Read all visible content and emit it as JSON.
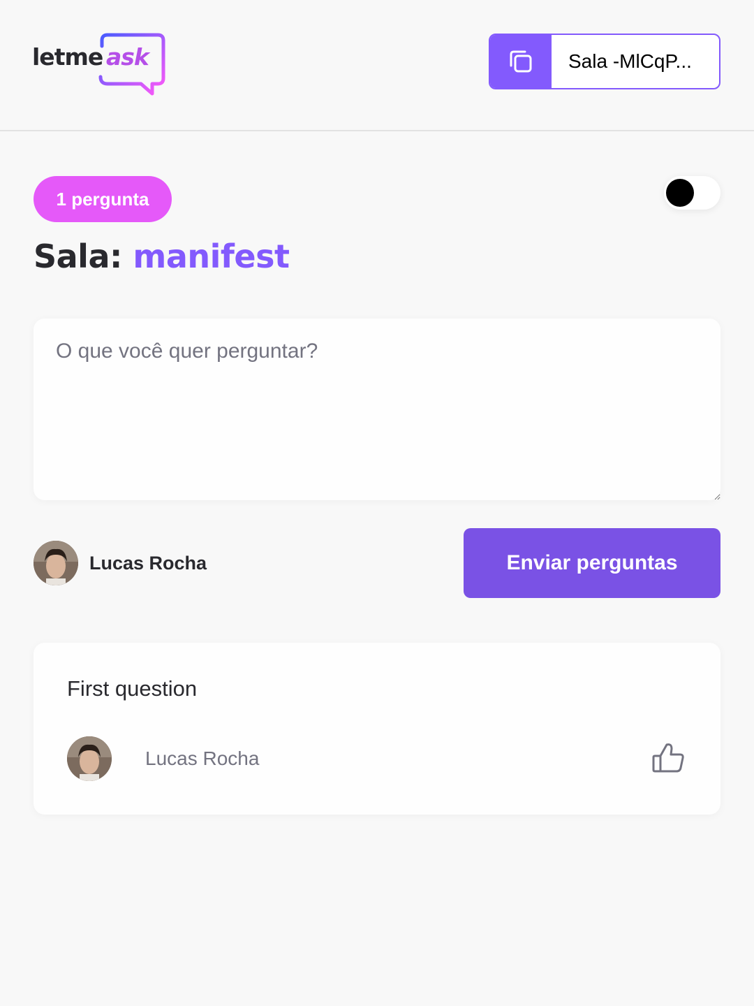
{
  "header": {
    "logo": {
      "text_letme": "letme",
      "text_ask": "ask"
    },
    "room_code": {
      "label": "Sala -MlCqP...",
      "icon": "copy-icon"
    }
  },
  "main": {
    "question_count_label": "1 pergunta",
    "theme_toggle": {
      "state": "off"
    },
    "title_prefix": "Sala:",
    "room_name": "manifest",
    "form": {
      "placeholder": "O que você quer perguntar?",
      "value": "",
      "user_name": "Lucas Rocha",
      "submit_label": "Enviar perguntas"
    },
    "questions": [
      {
        "content": "First question",
        "author": "Lucas Rocha",
        "icon": "like-icon"
      }
    ]
  },
  "colors": {
    "background": "#f8f8f8",
    "primary": "#835afd",
    "button": "#7a52e5",
    "badge": "#e559f9",
    "text": "#29292e",
    "muted": "#737380"
  }
}
